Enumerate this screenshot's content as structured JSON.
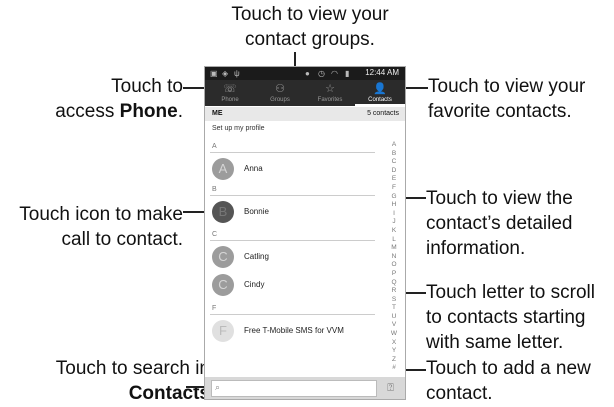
{
  "callouts": {
    "groups": [
      "Touch to view your",
      "contact groups."
    ],
    "phone_a": "Touch to",
    "phone_b_pre": "access ",
    "phone_b_bold": "Phone",
    "phone_b_post": ".",
    "favorites": [
      "Touch to view your",
      "favorite contacts."
    ],
    "call_icon": [
      "Touch icon to make",
      "call to contact."
    ],
    "details": [
      "Touch to view the",
      "contact’s detailed",
      "information."
    ],
    "letter": [
      "Touch letter to scroll",
      "to contacts starting",
      "with same letter."
    ],
    "search_a": "Touch to search in",
    "search_bold": "Contacts",
    "add": [
      "Touch to add a new",
      "contact."
    ]
  },
  "phone": {
    "status": {
      "time": "12:44",
      "ampm": "AM"
    },
    "tabs": [
      {
        "label": "Phone",
        "icon": "☏"
      },
      {
        "label": "Groups",
        "icon": "⚇"
      },
      {
        "label": "Favorites",
        "icon": "☆"
      },
      {
        "label": "Contacts",
        "icon": "👤"
      }
    ],
    "me_label": "ME",
    "contact_count": "5 contacts",
    "profile_text": "Set up my profile",
    "sections": [
      "A",
      "B",
      "C",
      "F"
    ],
    "contacts": [
      {
        "initial": "A",
        "name": "Anna"
      },
      {
        "initial": "B",
        "name": "Bonnie"
      },
      {
        "initial": "C",
        "name": "Catling"
      },
      {
        "initial": "C",
        "name": "Cindy"
      },
      {
        "initial": "F",
        "name": "Free T-Mobile SMS for VVM"
      }
    ],
    "alphabet": [
      "A",
      "B",
      "C",
      "D",
      "E",
      "F",
      "G",
      "H",
      "I",
      "J",
      "K",
      "L",
      "M",
      "N",
      "O",
      "P",
      "Q",
      "R",
      "S",
      "T",
      "U",
      "V",
      "W",
      "X",
      "Y",
      "Z",
      "#"
    ],
    "search_icon": "⌕",
    "add_icon": "⍰"
  }
}
